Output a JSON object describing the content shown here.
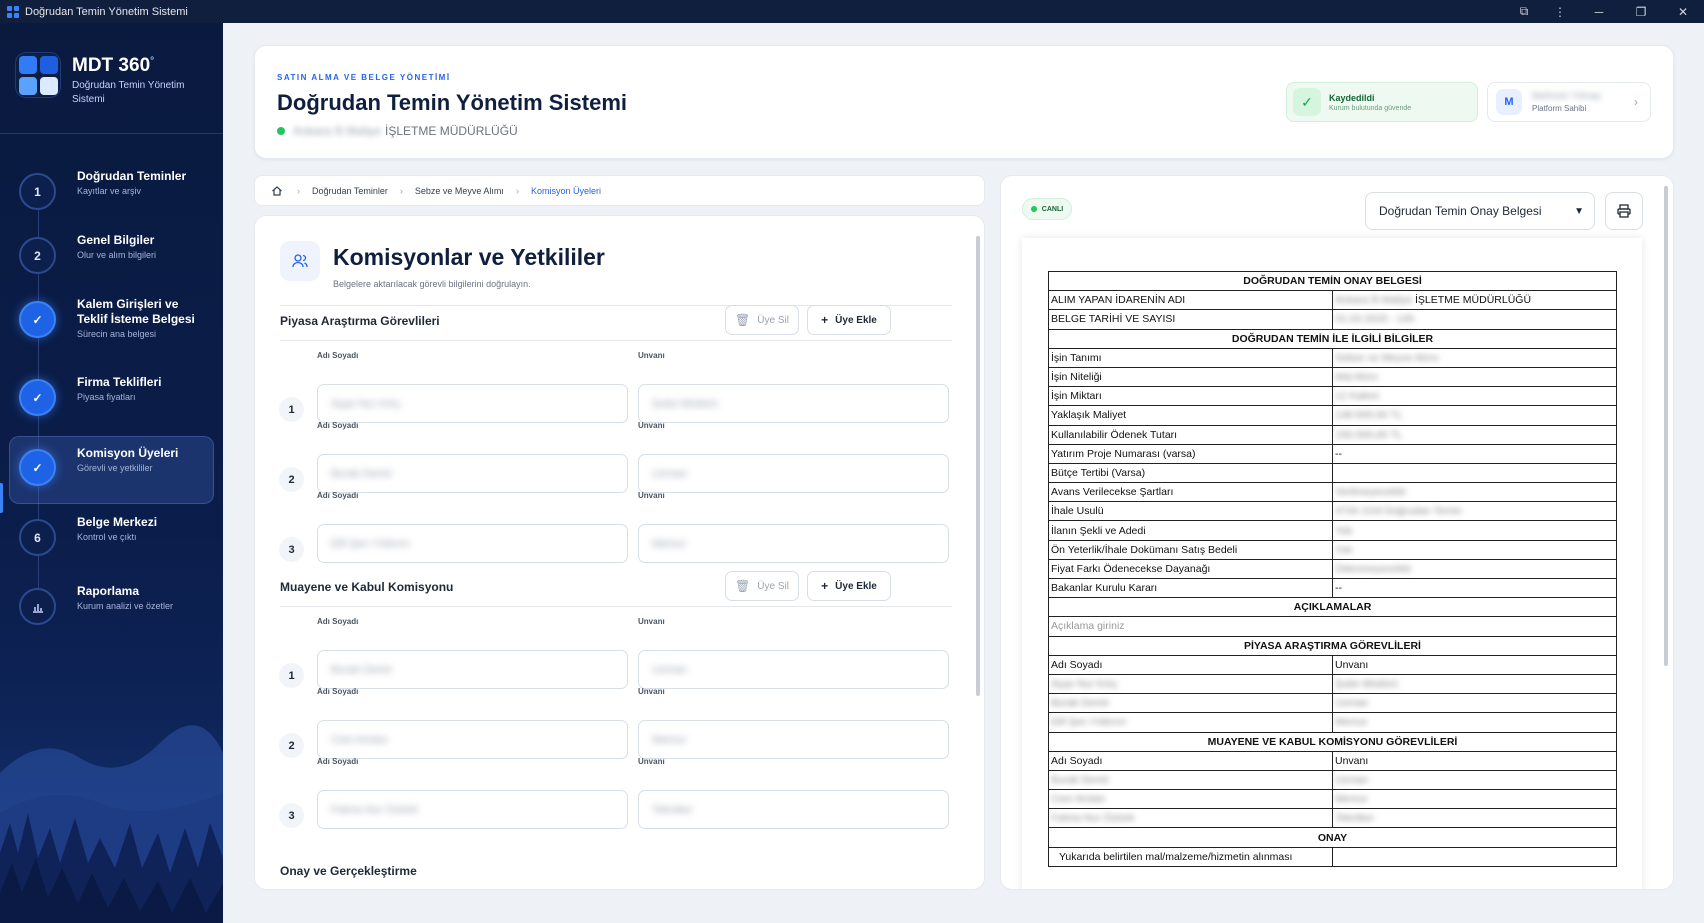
{
  "window": {
    "title": "Doğrudan Temin Yönetim Sistemi"
  },
  "brand": {
    "title": "MDT 360",
    "mark": "°",
    "subtitle": "Doğrudan Temin Yönetim Sistemi"
  },
  "steps": [
    {
      "num": "1",
      "title": "Doğrudan Teminler",
      "desc": "Kayıtlar ve arşiv",
      "state": "todo"
    },
    {
      "num": "2",
      "title": "Genel Bilgiler",
      "desc": "Olur ve alım bilgileri",
      "state": "todo"
    },
    {
      "num": "✓",
      "title": "Kalem Girişleri ve Teklif İsteme Belgesi",
      "desc": "Sürecin ana belgesi",
      "state": "done"
    },
    {
      "num": "✓",
      "title": "Firma Teklifleri",
      "desc": "Piyasa fiyatları",
      "state": "done"
    },
    {
      "num": "✓",
      "title": "Komisyon Üyeleri",
      "desc": "Görevli ve yetkililer",
      "state": "done"
    },
    {
      "num": "6",
      "title": "Belge Merkezi",
      "desc": "Kontrol ve çıktı",
      "state": "todo"
    },
    {
      "num": "📊",
      "title": "Raporlama",
      "desc": "Kurum analizi ve özetler",
      "state": "todo"
    }
  ],
  "header": {
    "kicker": "SATIN ALMA VE BELGE YÖNETİMİ",
    "title": "Doğrudan Temin Yönetim Sistemi",
    "org_blurred": "Ankara İli Maliye",
    "org_suffix": "İŞLETME MÜDÜRLÜĞÜ",
    "saved_title": "Kaydedildi",
    "saved_sub": "Kurum bulutunda güvende",
    "user_initial": "M",
    "user_name_blurred": "Mehmet Yılmaz",
    "user_role": "Platform Sahibi"
  },
  "breadcrumb": [
    "Doğrudan Teminler",
    "Sebze ve Meyve Alımı",
    "Komisyon Üyeleri"
  ],
  "section": {
    "title": "Komisyonlar ve Yetkililer",
    "desc": "Belgelere aktarılacak görevli bilgilerini doğrulayın.",
    "delete_label": "Üye Sil",
    "add_label": "Üye Ekle",
    "name_label": "Adı Soyadı",
    "title_label": "Unvanı",
    "groups": [
      {
        "title": "Piyasa Araştırma Görevlileri",
        "members": [
          {
            "num": "1",
            "name": "Ayşe Nur Kılıç",
            "title": "Şube Müdürü"
          },
          {
            "num": "2",
            "name": "Burak Demir",
            "title": "Uzman"
          },
          {
            "num": "3",
            "name": "Elif Şen Yıldırım",
            "title": "Memur"
          }
        ]
      },
      {
        "title": "Muayene ve Kabul Komisyonu",
        "members": [
          {
            "num": "1",
            "name": "Burak Demir",
            "title": "Uzman"
          },
          {
            "num": "2",
            "name": "Cem Arslan",
            "title": "Memur"
          },
          {
            "num": "3",
            "name": "Fatma Nur Öztürk",
            "title": "Tekniker"
          }
        ]
      }
    ],
    "next_group": "Onay ve Gerçekleştirme"
  },
  "preview": {
    "live_label": "CANLI",
    "doc_select": "Doğrudan Temin Onay Belgesi",
    "doc": {
      "title": "DOĞRUDAN TEMİN ONAY BELGESİ",
      "rows_top": [
        {
          "k": "ALIM YAPAN İDARENİN ADI",
          "v": "Ankara İli Maliye",
          "suffix": "İŞLETME MÜDÜRLÜĞÜ"
        },
        {
          "k": "BELGE TARİHİ VE SAYISI",
          "v": "01.03.2025 - 145"
        }
      ],
      "info_title": "DOĞRUDAN TEMİN İLE İLGİLİ BİLGİLER",
      "rows_info": [
        {
          "k": "İşin Tanımı",
          "v": "Sebze ve Meyve Alımı"
        },
        {
          "k": "İşin Niteliği",
          "v": "Mal Alımı"
        },
        {
          "k": "İşin Miktarı",
          "v": "12 Kalem"
        },
        {
          "k": "Yaklaşık Maliyet",
          "v": "148.500,00 TL"
        },
        {
          "k": "Kullanılabilir Ödenek Tutarı",
          "v": "150.000,00 TL"
        },
        {
          "k": "Yatırım Proje Numarası (varsa)",
          "v": "--",
          "plain": true
        },
        {
          "k": "Bütçe Tertibi (Varsa)",
          "v": "",
          "plain": true
        },
        {
          "k": "Avans Verilecekse Şartları",
          "v": "Verilmeyecektir"
        },
        {
          "k": "İhale Usulü",
          "v": "4734 22/d Doğrudan Temin"
        },
        {
          "k": "İlanın Şekli ve Adedi",
          "v": "Yok"
        },
        {
          "k": "Ön Yeterlik/İhale Dokümanı Satış Bedeli",
          "v": "Yok"
        },
        {
          "k": "Fiyat Farkı Ödenecekse Dayanağı",
          "v": "Ödenmeyecektir"
        },
        {
          "k": "Bakanlar Kurulu Kararı",
          "v": "--",
          "plain": true
        }
      ],
      "notes_title": "AÇIKLAMALAR",
      "notes_placeholder": "Açıklama giriniz",
      "pa_title": "PİYASA ARAŞTIRMA GÖREVLİLERİ",
      "name_col": "Adı Soyadı",
      "title_col": "Unvanı",
      "pa_rows": [
        {
          "n": "Ayşe Nur Kılıç",
          "t": "Şube Müdürü"
        },
        {
          "n": "Burak Demir",
          "t": "Uzman"
        },
        {
          "n": "Elif Şen Yıldırım",
          "t": "Memur"
        }
      ],
      "mk_title": "MUAYENE VE KABUL KOMİSYONU GÖREVLİLERİ",
      "mk_rows": [
        {
          "n": "Burak Demir",
          "t": "Uzman"
        },
        {
          "n": "Cem Arslan",
          "t": "Memur"
        },
        {
          "n": "Fatma Nur Öztürk",
          "t": "Tekniker"
        }
      ],
      "approve_title": "ONAY",
      "approve_text": "Yukarıda belirtilen mal/malzeme/hizmetin alınması"
    }
  },
  "colors": {
    "accent": "#2563eb",
    "sidebar": "#0b1d4a",
    "success": "#22c55e"
  }
}
